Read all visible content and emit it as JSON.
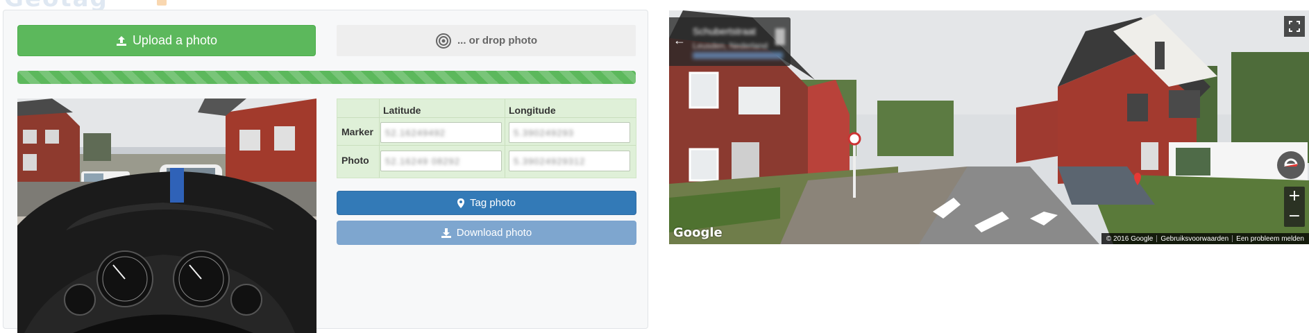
{
  "brand": {
    "logo_text": "Geotag"
  },
  "upload_button": {
    "label": "Upload a photo",
    "icon": "upload-icon"
  },
  "drop_zone": {
    "label": "... or drop photo",
    "icon": "target-icon"
  },
  "progress": {
    "percent": 100,
    "color": "#5cb85c"
  },
  "coordinates": {
    "headers": [
      "Latitude",
      "Longitude"
    ],
    "rows": [
      {
        "label": "Marker",
        "latitude": "52.16249492",
        "longitude": "5.390249293"
      },
      {
        "label": "Photo",
        "latitude": "52.16249 08292",
        "longitude": "5.39024929312"
      }
    ]
  },
  "tag_button": {
    "label": "Tag photo",
    "icon": "map-marker-icon"
  },
  "download_button": {
    "label": "Download photo",
    "icon": "download-icon"
  },
  "streetview": {
    "title": "Schubertstraat",
    "subtitle": "Leusden, Nederland",
    "watermark": "Google",
    "footer": [
      "© 2016 Google",
      "Gebruiksvoorwaarden",
      "Een probleem melden"
    ],
    "zoom_in": "+",
    "zoom_out": "−",
    "back_arrow": "←"
  },
  "colors": {
    "success": "#5cb85c",
    "primary": "#337ab7",
    "primary_disabled": "#7ea6cf",
    "table_bg": "#dff0d8"
  }
}
